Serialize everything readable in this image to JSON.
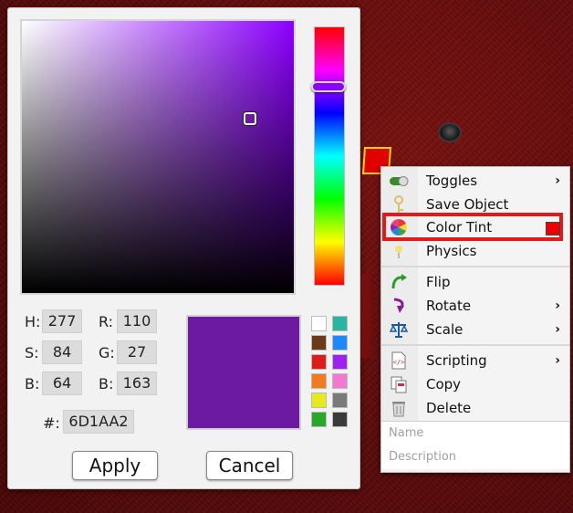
{
  "color_picker": {
    "hsb": {
      "h_label": "H:",
      "h": "277",
      "s_label": "S:",
      "s": "84",
      "b_label": "B:",
      "b": "64"
    },
    "rgb": {
      "r_label": "R:",
      "r": "110",
      "g_label": "G:",
      "g": "27",
      "b_label": "B:",
      "b": "163"
    },
    "hex_label": "#:",
    "hex": "6D1AA2",
    "selected_color": "#6d1aa2",
    "hue_color": "#8c00ff",
    "sv_cursor": {
      "saturation": 0.84,
      "brightness": 0.64
    },
    "hue_position": 0.23,
    "swatches": [
      "#ffffff",
      "#2ab5a0",
      "#6b3a1a",
      "#1e88ff",
      "#dd1c1c",
      "#a020f0",
      "#f47a1f",
      "#f07ad0",
      "#e8e81c",
      "#7a7a7a",
      "#28a828",
      "#3a3a3a"
    ],
    "apply_label": "Apply",
    "cancel_label": "Cancel"
  },
  "object": {
    "color": "#e00000",
    "outline": "#f3d400"
  },
  "context_menu": {
    "items": [
      {
        "label": "Toggles",
        "icon": "toggle-icon",
        "submenu": true
      },
      {
        "label": "Save Object",
        "icon": "key-icon",
        "submenu": false
      },
      {
        "label": "Color Tint",
        "icon": "color-wheel-icon",
        "submenu": false,
        "swatch": "#ee0000"
      },
      {
        "label": "Physics",
        "icon": "physics-icon",
        "submenu": false
      },
      {
        "label": "Flip",
        "icon": "flip-arrow-icon",
        "submenu": false
      },
      {
        "label": "Rotate",
        "icon": "rotate-arrow-icon",
        "submenu": true
      },
      {
        "label": "Scale",
        "icon": "scales-icon",
        "submenu": true
      },
      {
        "label": "Scripting",
        "icon": "script-file-icon",
        "submenu": true
      },
      {
        "label": "Copy",
        "icon": "copy-icon",
        "submenu": false
      },
      {
        "label": "Delete",
        "icon": "trash-icon",
        "submenu": false
      }
    ],
    "name_placeholder": "Name",
    "description_placeholder": "Description"
  }
}
